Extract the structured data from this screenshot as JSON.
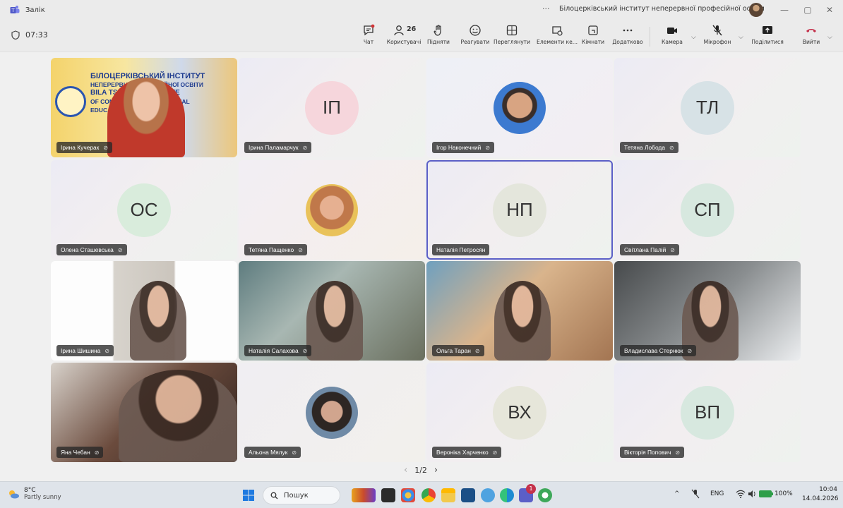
{
  "window": {
    "app_title": "Залік",
    "more": "···",
    "organization": "Білоцерківський інститут неперервної професійної освіти",
    "minimize": "—",
    "maximize": "▢",
    "close": "✕"
  },
  "toolbar": {
    "timer": "07:33",
    "buttons": {
      "chat": "Чат",
      "people": "Користувачі",
      "people_count": "26",
      "raise": "Підняти",
      "react": "Реагувати",
      "view": "Переглянути",
      "apps": "Елементи ке...",
      "rooms": "Кімнати",
      "more": "Додатково",
      "camera": "Камера",
      "mic": "Мікрофон",
      "share": "Поділитися",
      "leave": "Вийти"
    }
  },
  "participants": [
    {
      "name": "Ірина Кучерак",
      "initials": "",
      "muted": true
    },
    {
      "name": "Ірина Паламарчук",
      "initials": "ІП",
      "muted": true
    },
    {
      "name": "Ігор Наконечний",
      "initials": "",
      "muted": true
    },
    {
      "name": "Тетяна Лобода",
      "initials": "ТЛ",
      "muted": true
    },
    {
      "name": "Олена Сташевська",
      "initials": "ОС",
      "muted": true
    },
    {
      "name": "Тетяна Пащенко",
      "initials": "",
      "muted": true
    },
    {
      "name": "Наталія Петросян",
      "initials": "НП",
      "muted": false
    },
    {
      "name": "Світлана Палій",
      "initials": "СП",
      "muted": true
    },
    {
      "name": "Ірина Шишина",
      "initials": "",
      "muted": true
    },
    {
      "name": "Наталія Салахова",
      "initials": "",
      "muted": true
    },
    {
      "name": "Ольга Таран",
      "initials": "",
      "muted": true
    },
    {
      "name": "Владислава Стернюк",
      "initials": "",
      "muted": true
    },
    {
      "name": "Яна Чебан",
      "initials": "",
      "muted": true
    },
    {
      "name": "Альона Мялук",
      "initials": "",
      "muted": true
    },
    {
      "name": "Вероніка Харченко",
      "initials": "ВХ",
      "muted": true
    },
    {
      "name": "Вікторія Попович",
      "initials": "ВП",
      "muted": true
    }
  ],
  "banner": {
    "line1": "БІЛОЦЕРКІВСЬКИЙ ІНСТИТУТ",
    "line2": "НЕПЕРЕРВНОЇ ПРОФЕСІЙНОЇ ОСВІТИ",
    "line3": "BILA TSERKVA INSTITUTE",
    "line4": "OF CONTINUOUS PROFESSIONAL",
    "line5": "EDUCATION"
  },
  "pager": {
    "prev": "‹",
    "page": "1/2",
    "next": "›"
  },
  "taskbar": {
    "weather_temp": "8°C",
    "weather_desc": "Partly sunny",
    "search_placeholder": "Пошук",
    "lang": "ENG",
    "battery": "100%",
    "time": "10:04",
    "date": "14.04.2026",
    "chevron": "^",
    "notification_count": "1"
  }
}
